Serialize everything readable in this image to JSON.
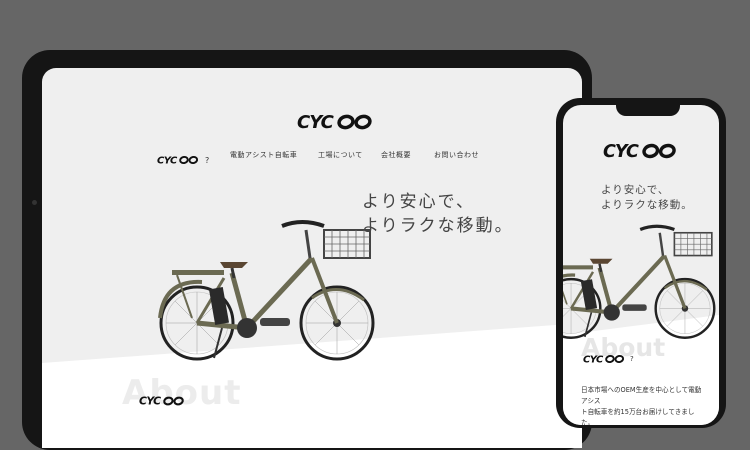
{
  "brand": {
    "logo_text": "CYCOO"
  },
  "tablet": {
    "nav": {
      "brand_suffix": "?",
      "items": [
        "電動アシスト自転車",
        "工場について",
        "会社概要",
        "お問い合わせ"
      ]
    },
    "hero": {
      "line1": "より安心で、",
      "line2": "よりラクな移動。"
    },
    "about": {
      "heading": "About"
    }
  },
  "phone": {
    "hero": {
      "line1": "より安心で、",
      "line2": "よりラクな移動。"
    },
    "about": {
      "heading": "About",
      "brand_suffix": "?",
      "body_line1": "日本市場へのOEM生産を中心として電動アシス",
      "body_line2": "ト自転車を約15万台お届けしてきました。"
    }
  },
  "colors": {
    "background": "#666666",
    "device": "#151515",
    "screen": "#efefef",
    "bike_frame": "#6b6a52"
  }
}
